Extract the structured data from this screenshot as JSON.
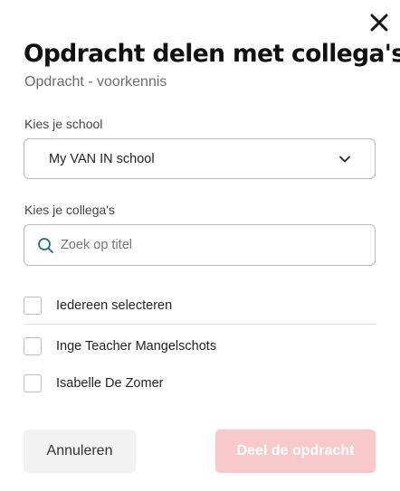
{
  "dialog": {
    "title": "Opdracht delen met collega's",
    "subtitle": "Opdracht - voorkennis"
  },
  "school": {
    "label": "Kies je school",
    "selected": "My VAN IN school"
  },
  "colleagues": {
    "label": "Kies je collega's",
    "search_placeholder": "Zoek op titel",
    "select_all": "Iedereen selecteren",
    "list": [
      {
        "name": "Inge Teacher Mangelschots",
        "checked": false
      },
      {
        "name": "Isabelle De Zomer",
        "checked": false
      }
    ]
  },
  "actions": {
    "cancel_label": "Annuleren",
    "share_label": "Deel de opdracht"
  },
  "colors": {
    "accent_disabled": "#f7c9cb",
    "search_icon": "#1f6f73"
  },
  "icons": {
    "close": "close-icon",
    "dropdown": "chevron-down-icon",
    "search": "search-icon"
  }
}
